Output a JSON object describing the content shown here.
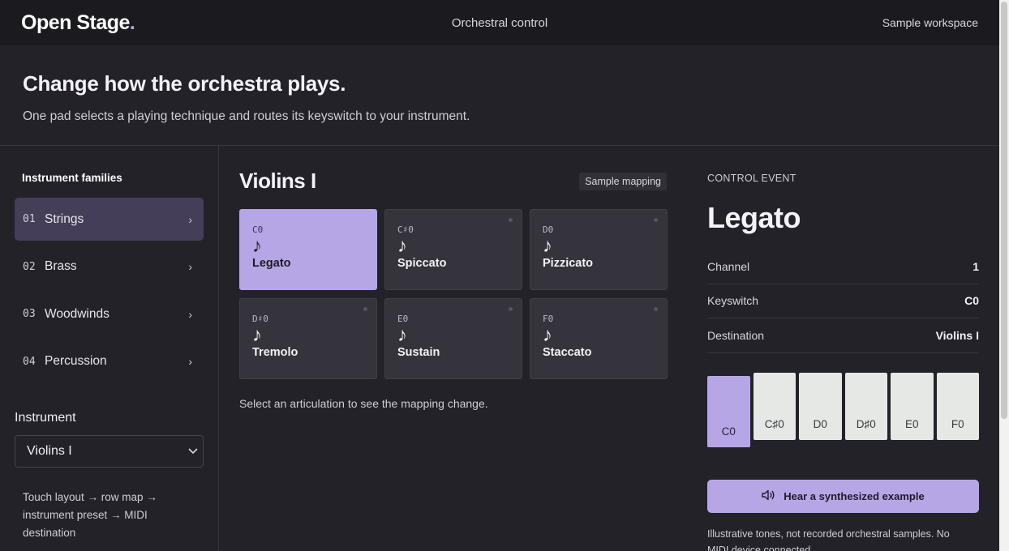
{
  "topbar": {
    "logo": "Open Stage",
    "logo_dot": ".",
    "center": "Orchestral control",
    "right": "Sample workspace"
  },
  "hero": {
    "title": "Change how the orchestra plays.",
    "subtitle": "One pad selects a playing technique and routes its keyswitch to your instrument."
  },
  "sidebar": {
    "heading": "Instrument families",
    "families": [
      {
        "num": "01",
        "label": "Strings",
        "active": true
      },
      {
        "num": "02",
        "label": "Brass",
        "active": false
      },
      {
        "num": "03",
        "label": "Woodwinds",
        "active": false
      },
      {
        "num": "04",
        "label": "Percussion",
        "active": false
      }
    ],
    "chevron": "›",
    "instrument_label": "Instrument",
    "instrument_value": "Violins I",
    "flow_text": "Touch layout → row map → instrument preset → MIDI destination"
  },
  "center": {
    "title": "Violins I",
    "badge": "Sample mapping",
    "pads": [
      {
        "key": "C0",
        "name": "Legato",
        "icon": "music-note-icon",
        "glyph": "♪",
        "active": true
      },
      {
        "key": "C♯0",
        "name": "Spiccato",
        "icon": "music-note-icon",
        "glyph": "♪",
        "active": false
      },
      {
        "key": "D0",
        "name": "Pizzicato",
        "icon": "music-note-icon",
        "glyph": "♪",
        "active": false
      },
      {
        "key": "D♯0",
        "name": "Tremolo",
        "icon": "music-note-icon",
        "glyph": "♪",
        "active": false
      },
      {
        "key": "E0",
        "name": "Sustain",
        "icon": "music-note-icon",
        "glyph": "♪",
        "active": false
      },
      {
        "key": "F0",
        "name": "Staccato",
        "icon": "music-note-icon",
        "glyph": "♪",
        "active": false
      }
    ],
    "hint": "Select an articulation to see the mapping change."
  },
  "control_event": {
    "label": "CONTROL EVENT",
    "title": "Legato",
    "rows": [
      {
        "key": "Channel",
        "value": "1"
      },
      {
        "key": "Keyswitch",
        "value": "C0"
      },
      {
        "key": "Destination",
        "value": "Violins I"
      }
    ],
    "keys": [
      {
        "label": "C0",
        "active": true
      },
      {
        "label": "C♯0",
        "active": false
      },
      {
        "label": "D0",
        "active": false
      },
      {
        "label": "D♯0",
        "active": false
      },
      {
        "label": "E0",
        "active": false
      },
      {
        "label": "F0",
        "active": false
      }
    ],
    "button_label": "Hear a synthesized example",
    "button_icon": "speaker-icon",
    "note": "Illustrative tones, not recorded orchestral samples. No MIDI device connected."
  },
  "colors": {
    "accent": "#b6a6e6",
    "background": "#232228",
    "topbar": "#1b1a1f",
    "active_family": "#453e58"
  }
}
